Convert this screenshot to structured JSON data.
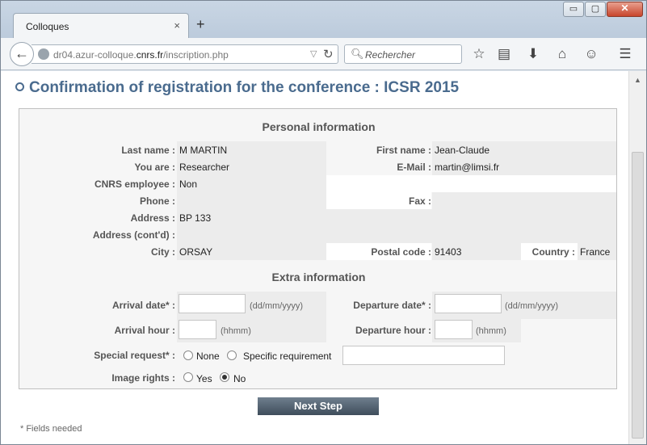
{
  "browser": {
    "tab_title": "Colloques",
    "tab_close": "×",
    "new_tab": "+",
    "url_prefix": "dr04.azur-colloque.",
    "url_domain": "cnrs.fr",
    "url_path": "/inscription.php",
    "search_placeholder": "Rechercher",
    "window_minimize": "▭",
    "window_maximize": "▢",
    "window_close": "✕"
  },
  "page": {
    "title": "Confirmation of registration for the conference : ICSR 2015",
    "personal_section": "Personal information",
    "extra_section": "Extra information",
    "next_button": "Next Step",
    "footnote": "* Fields needed"
  },
  "personal": {
    "last_name_label": "Last name :",
    "last_name": "M MARTIN",
    "first_name_label": "First name :",
    "first_name": "Jean-Claude",
    "you_are_label": "You are :",
    "you_are": "Researcher",
    "email_label": "E-Mail :",
    "email": "martin@limsi.fr",
    "cnrs_label": "CNRS employee :",
    "cnrs": "Non",
    "phone_label": "Phone :",
    "phone": "",
    "fax_label": "Fax :",
    "fax": "",
    "address_label": "Address :",
    "address": "BP 133",
    "address2_label": "Address (cont'd) :",
    "address2": "",
    "city_label": "City :",
    "city": "ORSAY",
    "postal_label": "Postal code :",
    "postal": "91403",
    "country_label": "Country :",
    "country": "France"
  },
  "extra": {
    "arrival_date_label": "Arrival date* :",
    "arrival_date_value": "",
    "arrival_date_hint": "(dd/mm/yyyy)",
    "departure_date_label": "Departure date* :",
    "departure_date_value": "",
    "departure_date_hint": "(dd/mm/yyyy)",
    "arrival_hour_label": "Arrival hour :",
    "arrival_hour_value": "",
    "arrival_hour_hint": "(hhmm)",
    "departure_hour_label": "Departure hour :",
    "departure_hour_value": "",
    "departure_hour_hint": "(hhmm)",
    "special_label": "Special request* :",
    "special_none": "None",
    "special_specific": "Specific requirement",
    "special_text": "",
    "image_label": "Image rights :",
    "image_yes": "Yes",
    "image_no": "No",
    "image_selected": "No"
  }
}
